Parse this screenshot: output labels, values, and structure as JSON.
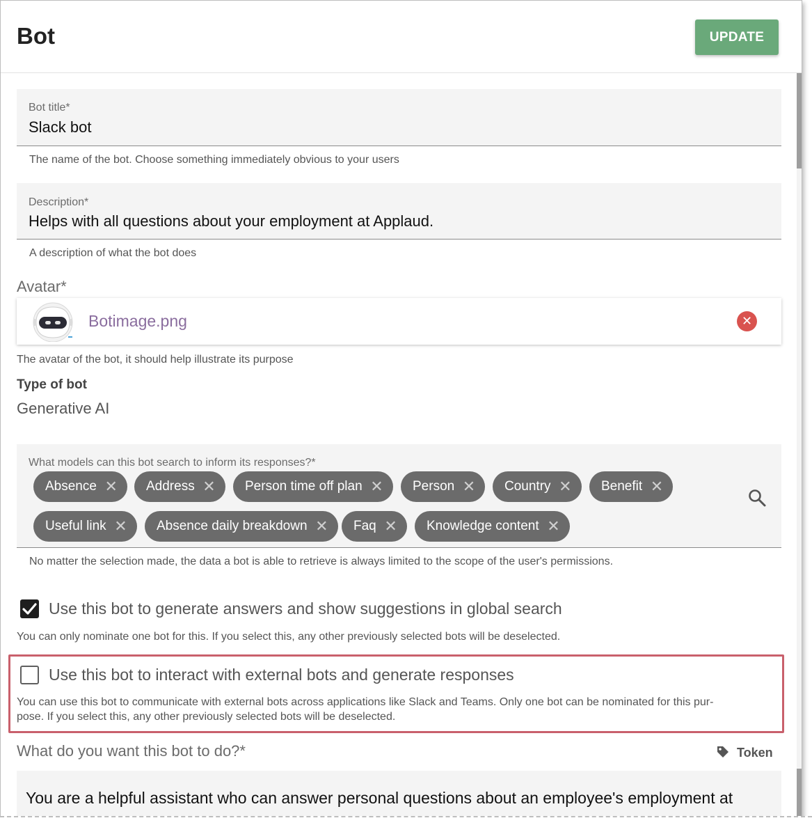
{
  "header": {
    "title": "Bot",
    "update_label": "UPDATE"
  },
  "bot_title": {
    "label": "Bot title*",
    "value": "Slack bot",
    "helper": "The name of the bot. Choose something immediately obvious to your users"
  },
  "description": {
    "label": "Description*",
    "value": "Helps with all questions about your employment at Applaud.",
    "helper": "A description of what the bot does"
  },
  "avatar": {
    "label": "Avatar*",
    "file_name": "Botimage.png",
    "helper": "The avatar of the bot, it should help illustrate its purpose"
  },
  "type": {
    "label": "Type of bot",
    "value": "Generative AI"
  },
  "models": {
    "label": "What models can this bot search to inform its responses?*",
    "chips": [
      "Absence",
      "Address",
      "Person time off plan",
      "Person",
      "Country",
      "Benefit",
      "Useful link",
      "Absence daily breakdown",
      "Faq",
      "Knowledge content"
    ],
    "helper": "No matter the selection made, the data a bot is able to retrieve is always limited to the scope of the user's permissions."
  },
  "global_search": {
    "checked": true,
    "label": "Use this bot to generate answers and show suggestions in global search",
    "helper": "You can only nominate one bot for this. If you select this, any other previously selected bots will be deselected."
  },
  "external_bots": {
    "checked": false,
    "label": "Use this bot to interact with external bots and generate responses",
    "helper_line1": "You can use this bot to communicate with external bots across applications like Slack and Teams. Only one bot can be nominated for this pur-",
    "helper_line2": "pose. If you select this, any other previously selected bots will be deselected."
  },
  "prompt": {
    "label": "What do you want this bot to do?*",
    "token_label": "Token",
    "text": "You are a helpful assistant who can answer personal questions about an employee's employment at"
  },
  "colors": {
    "accent": "#6aa97a",
    "chip": "#6b6b6b",
    "highlight": "#c9606c",
    "remove": "#d9534f"
  },
  "icons": [
    "close-icon",
    "search-icon",
    "check-icon",
    "tag-icon",
    "bot-avatar-image"
  ]
}
